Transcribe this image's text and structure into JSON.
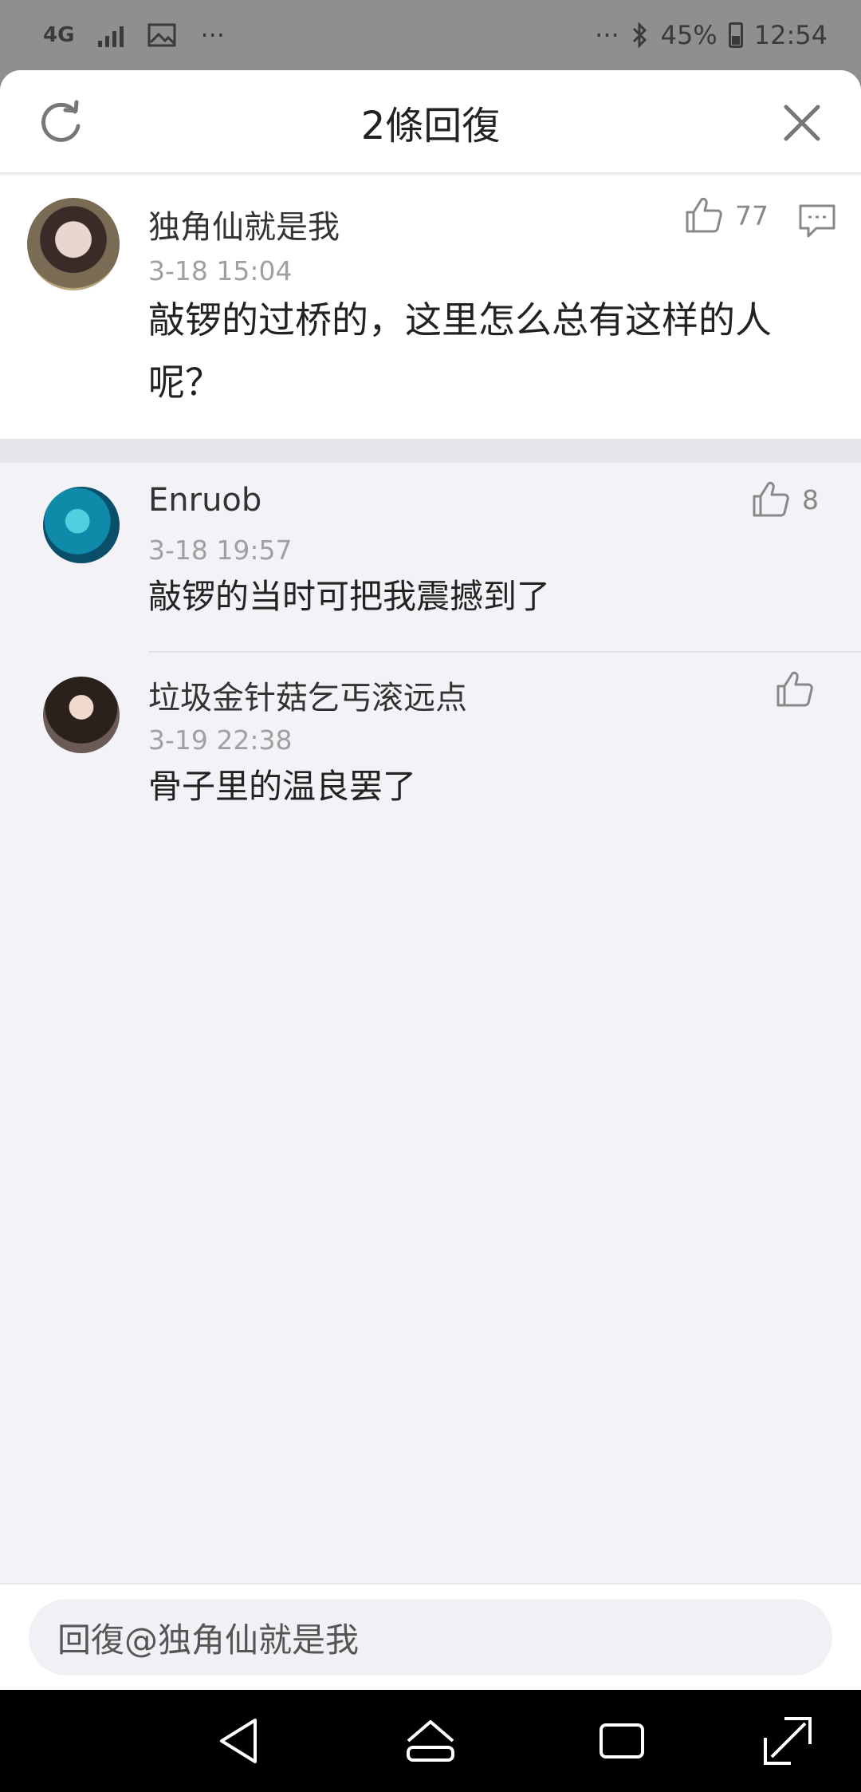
{
  "status_bar": {
    "network": "4G",
    "dots_left": "···",
    "dots_right": "···",
    "battery": "45%",
    "time": "12:54"
  },
  "sheet": {
    "title": "2條回復"
  },
  "main_comment": {
    "author": "独角仙就是我",
    "time": "3-18 15:04",
    "text_line1": "敲锣的过桥的，这里怎么总有这样的人",
    "text_line2": "呢？",
    "likes": "77"
  },
  "replies": [
    {
      "author": "Enruob",
      "time": "3-18 19:57",
      "text": "敲锣的当时可把我震撼到了",
      "likes": "8"
    },
    {
      "author": "垃圾金针菇乞丐滚远点",
      "time": "3-19 22:38",
      "text": "骨子里的温良罢了",
      "likes": ""
    }
  ],
  "input": {
    "placeholder": "回復@独角仙就是我"
  },
  "colors": {
    "sheet_bg": "#f3f3f7",
    "status_bg": "#8f8f8f",
    "muted_text": "#a0a0a0"
  },
  "icons": [
    "refresh-icon",
    "close-icon",
    "thumb-up-icon",
    "comment-icon",
    "back-icon",
    "home-icon",
    "recents-icon",
    "expand-icon"
  ]
}
